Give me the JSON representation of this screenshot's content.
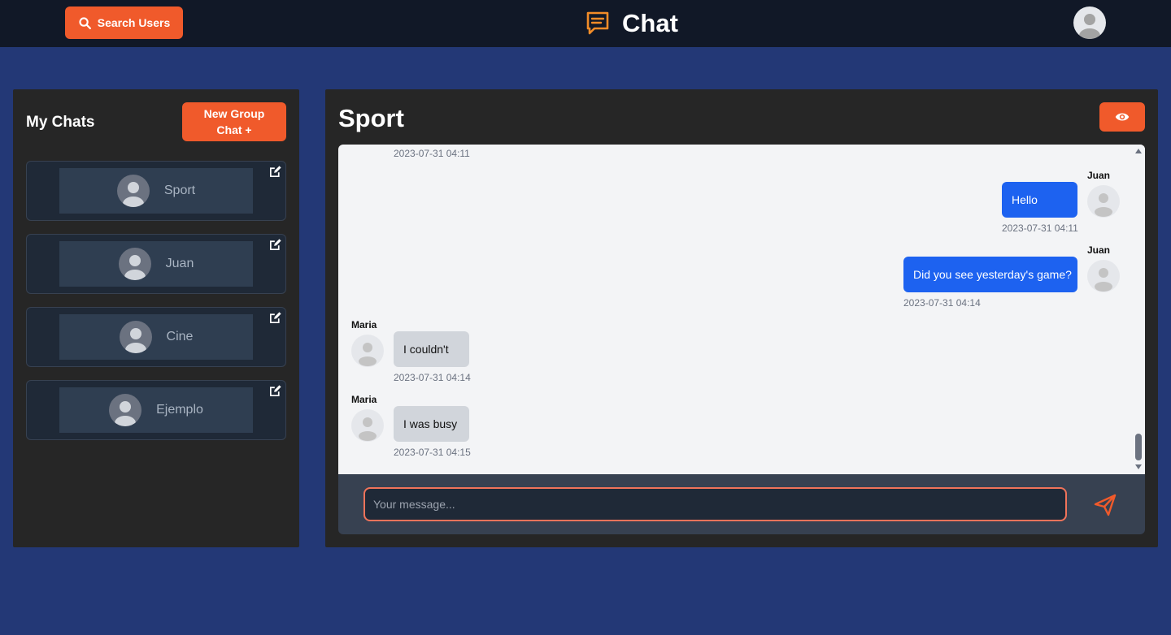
{
  "header": {
    "search_label": "Search Users",
    "brand_title": "Chat",
    "icons": {
      "search": "search-icon",
      "brand": "chat-bubble-icon",
      "avatar": "user-avatar-icon"
    }
  },
  "sidebar": {
    "title": "My Chats",
    "new_group_line1": "New Group",
    "new_group_line2": "Chat +",
    "chats": [
      {
        "name": "Sport"
      },
      {
        "name": "Juan"
      },
      {
        "name": "Cine"
      },
      {
        "name": "Ejemplo"
      }
    ]
  },
  "conversation": {
    "title": "Sport",
    "first_timestamp": "2023-07-31 04:11",
    "messages": [
      {
        "sender": "Juan",
        "text": "Hello",
        "timestamp": "2023-07-31 04:11",
        "direction": "outgoing"
      },
      {
        "sender": "Juan",
        "text": "Did you see yesterday's game?",
        "timestamp": "2023-07-31 04:14",
        "direction": "outgoing"
      },
      {
        "sender": "Maria",
        "text": "I couldn't",
        "timestamp": "2023-07-31 04:14",
        "direction": "incoming"
      },
      {
        "sender": "Maria",
        "text": "I was busy",
        "timestamp": "2023-07-31 04:15",
        "direction": "incoming"
      }
    ]
  },
  "composer": {
    "placeholder": "Your message..."
  },
  "colors": {
    "accent": "#f05a2b",
    "page_bg": "#233876",
    "topbar_bg": "#111827",
    "outgoing_bubble": "#1d62f0",
    "incoming_bubble": "#d1d5db"
  }
}
